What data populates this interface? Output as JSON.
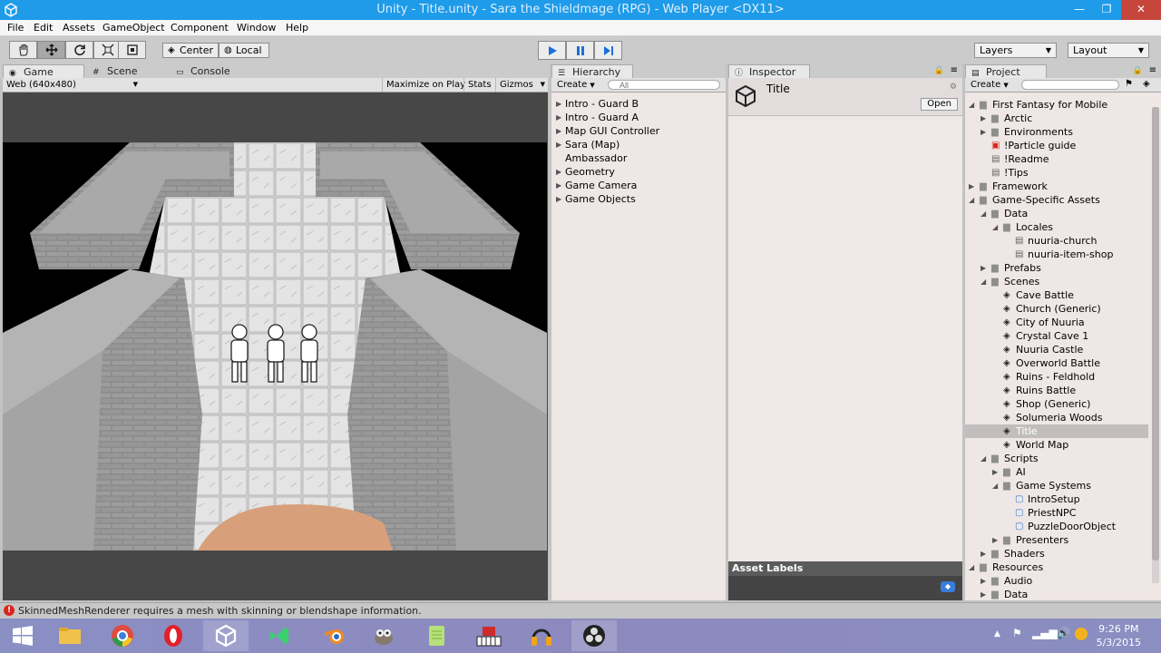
{
  "window": {
    "title": "Unity - Title.unity - Sara the Shieldmage (RPG) - Web Player <DX11>",
    "minimize": "—",
    "maximize": "❐",
    "close": "✕"
  },
  "menu": [
    "File",
    "Edit",
    "Assets",
    "GameObject",
    "Component",
    "Window",
    "Help"
  ],
  "toolbar": {
    "tools": [
      "hand-icon",
      "move-icon",
      "rotate-icon",
      "scale-icon",
      "rect-icon"
    ],
    "pivot_center": "Center",
    "pivot_local": "Local",
    "layers": "Layers",
    "layout": "Layout"
  },
  "game_panel": {
    "tabs": {
      "game": "Game",
      "scene": "Scene",
      "console": "Console"
    },
    "resolution": "Web (640x480)",
    "maximize_on_play": "Maximize on Play",
    "stats": "Stats",
    "gizmos": "Gizmos"
  },
  "hierarchy": {
    "tab": "Hierarchy",
    "create": "Create",
    "search_placeholder": "All",
    "items": [
      {
        "label": "Intro - Guard B",
        "expandable": true
      },
      {
        "label": "Intro - Guard A",
        "expandable": true
      },
      {
        "label": "Map GUI Controller",
        "expandable": true
      },
      {
        "label": "Sara (Map)",
        "expandable": true
      },
      {
        "label": "Ambassador",
        "expandable": false
      },
      {
        "label": "Geometry",
        "expandable": true
      },
      {
        "label": "Game Camera",
        "expandable": true
      },
      {
        "label": "Game Objects",
        "expandable": true
      }
    ]
  },
  "inspector": {
    "tab": "Inspector",
    "object_title": "Title",
    "open_button": "Open",
    "asset_labels": "Asset Labels"
  },
  "project": {
    "tab": "Project",
    "create": "Create",
    "tree": [
      {
        "label": "First Fantasy for Mobile",
        "depth": 0,
        "kind": "folder",
        "state": "open"
      },
      {
        "label": "Arctic",
        "depth": 1,
        "kind": "folder",
        "state": "closed"
      },
      {
        "label": "Environments",
        "depth": 1,
        "kind": "folder",
        "state": "closed"
      },
      {
        "label": "!Particle guide",
        "depth": 1,
        "kind": "pdf",
        "state": "leaf"
      },
      {
        "label": "!Readme",
        "depth": 1,
        "kind": "doc",
        "state": "leaf"
      },
      {
        "label": "!Tips",
        "depth": 1,
        "kind": "doc",
        "state": "leaf"
      },
      {
        "label": "Framework",
        "depth": 0,
        "kind": "folder",
        "state": "closed"
      },
      {
        "label": "Game-Specific Assets",
        "depth": 0,
        "kind": "folder",
        "state": "open"
      },
      {
        "label": "Data",
        "depth": 1,
        "kind": "folder",
        "state": "open"
      },
      {
        "label": "Locales",
        "depth": 2,
        "kind": "folder",
        "state": "open"
      },
      {
        "label": "nuuria-church",
        "depth": 3,
        "kind": "doc",
        "state": "leaf"
      },
      {
        "label": "nuuria-item-shop",
        "depth": 3,
        "kind": "doc",
        "state": "leaf"
      },
      {
        "label": "Prefabs",
        "depth": 1,
        "kind": "folder",
        "state": "closed"
      },
      {
        "label": "Scenes",
        "depth": 1,
        "kind": "folder",
        "state": "open"
      },
      {
        "label": "Cave Battle",
        "depth": 2,
        "kind": "scene",
        "state": "leaf"
      },
      {
        "label": "Church (Generic)",
        "depth": 2,
        "kind": "scene",
        "state": "leaf"
      },
      {
        "label": "City of Nuuria",
        "depth": 2,
        "kind": "scene",
        "state": "leaf"
      },
      {
        "label": "Crystal Cave 1",
        "depth": 2,
        "kind": "scene",
        "state": "leaf"
      },
      {
        "label": "Nuuria Castle",
        "depth": 2,
        "kind": "scene",
        "state": "leaf"
      },
      {
        "label": "Overworld Battle",
        "depth": 2,
        "kind": "scene",
        "state": "leaf"
      },
      {
        "label": "Ruins - Feldhold",
        "depth": 2,
        "kind": "scene",
        "state": "leaf"
      },
      {
        "label": "Ruins Battle",
        "depth": 2,
        "kind": "scene",
        "state": "leaf"
      },
      {
        "label": "Shop (Generic)",
        "depth": 2,
        "kind": "scene",
        "state": "leaf"
      },
      {
        "label": "Solumeria Woods",
        "depth": 2,
        "kind": "scene",
        "state": "leaf"
      },
      {
        "label": "Title",
        "depth": 2,
        "kind": "scene",
        "state": "leaf",
        "selected": true
      },
      {
        "label": "World Map",
        "depth": 2,
        "kind": "scene",
        "state": "leaf"
      },
      {
        "label": "Scripts",
        "depth": 1,
        "kind": "folder",
        "state": "open"
      },
      {
        "label": "AI",
        "depth": 2,
        "kind": "folder",
        "state": "closed"
      },
      {
        "label": "Game Systems",
        "depth": 2,
        "kind": "folder",
        "state": "open"
      },
      {
        "label": "IntroSetup",
        "depth": 3,
        "kind": "script",
        "state": "leaf"
      },
      {
        "label": "PriestNPC",
        "depth": 3,
        "kind": "script",
        "state": "leaf"
      },
      {
        "label": "PuzzleDoorObject",
        "depth": 3,
        "kind": "script",
        "state": "leaf"
      },
      {
        "label": "Presenters",
        "depth": 2,
        "kind": "folder",
        "state": "closed"
      },
      {
        "label": "Shaders",
        "depth": 1,
        "kind": "folder",
        "state": "closed"
      },
      {
        "label": "Resources",
        "depth": 0,
        "kind": "folder",
        "state": "open"
      },
      {
        "label": "Audio",
        "depth": 1,
        "kind": "folder",
        "state": "closed"
      },
      {
        "label": "Data",
        "depth": 1,
        "kind": "folder",
        "state": "closed"
      }
    ]
  },
  "status": {
    "message": "SkinnedMeshRenderer requires a mesh with skinning or blendshape information."
  },
  "taskbar": {
    "apps": [
      "windows-start-icon",
      "file-explorer-icon",
      "chrome-icon",
      "opera-icon",
      "unity-icon",
      "visual-studio-icon",
      "blender-icon",
      "gimp-icon",
      "notepad-icon",
      "piano-icon",
      "audio-headphones-icon",
      "obs-icon"
    ],
    "time": "9:26 PM",
    "date": "5/3/2015"
  },
  "colors": {
    "titlebar": "#1e9be9",
    "play_blue": "#1a6fd8",
    "error_red": "#d9261c"
  }
}
